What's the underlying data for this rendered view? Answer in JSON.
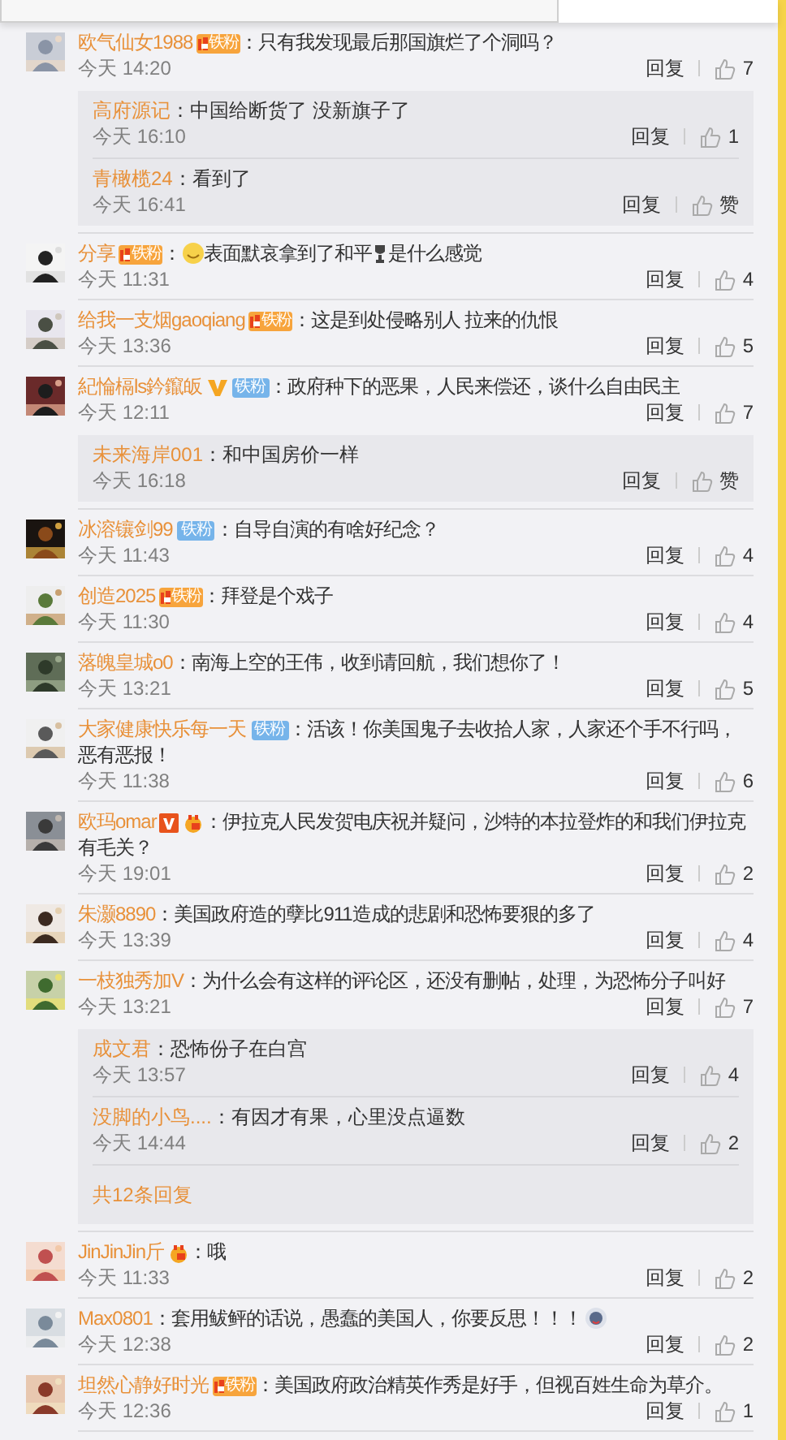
{
  "comments": [
    {
      "user": "欧气仙女1988",
      "badges": [
        {
          "kind": "fan",
          "label": "铁粉"
        }
      ],
      "content": [
        {
          "kind": "text",
          "text": "：只有我发现最后那国旗烂了个洞吗？"
        }
      ],
      "time": "今天 14:20",
      "reply": "回复",
      "likes": "7",
      "replies": [
        {
          "user": "高府源记",
          "content": "：中国给断货了 没新旗子了",
          "time": "今天 16:10",
          "reply": "回复",
          "likes": "1"
        },
        {
          "user": "青橄榄24",
          "content": "：看到了",
          "time": "今天 16:41",
          "reply": "回复",
          "likes": "赞"
        }
      ]
    },
    {
      "user": "分享",
      "badges": [
        {
          "kind": "fan",
          "label": "铁粉"
        }
      ],
      "content": [
        {
          "kind": "text",
          "text": "："
        },
        {
          "kind": "smiley"
        },
        {
          "kind": "text",
          "text": "表面默哀拿到了和平"
        },
        {
          "kind": "trophy"
        },
        {
          "kind": "text",
          "text": "是什么感觉"
        }
      ],
      "time": "今天 11:31",
      "reply": "回复",
      "likes": "4"
    },
    {
      "user": "给我一支烟gaoqiang",
      "badges": [
        {
          "kind": "fan",
          "label": "铁粉"
        }
      ],
      "content": [
        {
          "kind": "text",
          "text": "：这是到处侵略别人 拉来的仇恨"
        }
      ],
      "time": "今天 13:36",
      "reply": "回复",
      "likes": "5"
    },
    {
      "user": "紀惀槅ls鈐鑹皈",
      "badges": [
        {
          "kind": "v"
        },
        {
          "kind": "fan_blue",
          "label": "铁粉"
        }
      ],
      "content": [
        {
          "kind": "text",
          "text": "：政府种下的恶果，人民来偿还，谈什么自由民主"
        }
      ],
      "time": "今天 12:11",
      "reply": "回复",
      "likes": "7",
      "replies": [
        {
          "user": "未来海岸001",
          "content": "：和中国房价一样",
          "time": "今天 16:18",
          "reply": "回复",
          "likes": "赞"
        }
      ]
    },
    {
      "user": "冰溶镶剑99",
      "badges": [
        {
          "kind": "fan_blue",
          "label": "铁粉"
        }
      ],
      "content": [
        {
          "kind": "text",
          "text": "：自导自演的有啥好纪念？"
        }
      ],
      "time": "今天 11:43",
      "reply": "回复",
      "likes": "4"
    },
    {
      "user": "创造2025",
      "badges": [
        {
          "kind": "fan",
          "label": "铁粉"
        }
      ],
      "content": [
        {
          "kind": "text",
          "text": "：拜登是个戏子"
        }
      ],
      "time": "今天 11:30",
      "reply": "回复",
      "likes": "4"
    },
    {
      "user": "落魄皇城o0",
      "content": [
        {
          "kind": "text",
          "text": "：南海上空的王伟，收到请回航，我们想你了！"
        }
      ],
      "time": "今天 13:21",
      "reply": "回复",
      "likes": "5"
    },
    {
      "user": "大家健康快乐每一天",
      "badges": [
        {
          "kind": "fan_blue",
          "label": "铁粉"
        }
      ],
      "content": [
        {
          "kind": "text",
          "text": "：活该！你美国鬼子去收拾人家，人家还个手不行吗，恶有恶报！"
        }
      ],
      "time": "今天 11:38",
      "reply": "回复",
      "likes": "6"
    },
    {
      "user": "欧玛omar",
      "badges": [
        {
          "kind": "v_box"
        },
        {
          "kind": "medal"
        }
      ],
      "content": [
        {
          "kind": "text",
          "text": "：伊拉克人民发贺电庆祝并疑问，沙特的本拉登炸的和我们伊拉克有毛关？"
        }
      ],
      "time": "今天 19:01",
      "reply": "回复",
      "likes": "2"
    },
    {
      "user": "朱灏8890",
      "content": [
        {
          "kind": "text",
          "text": "：美国政府造的孽比911造成的悲剧和恐怖要狠的多了"
        }
      ],
      "time": "今天 13:39",
      "reply": "回复",
      "likes": "4"
    },
    {
      "user": "一枝独秀加V",
      "content": [
        {
          "kind": "text",
          "text": "：为什么会有这样的评论区，还没有删帖，处理，为恐怖分子叫好"
        }
      ],
      "time": "今天 13:21",
      "reply": "回复",
      "likes": "7",
      "replies": [
        {
          "user": "成文君",
          "content": "：恐怖份子在白宫",
          "time": "今天 13:57",
          "reply": "回复",
          "likes": "4"
        },
        {
          "user": "没脚的小鸟....",
          "content": "：有因才有果，心里没点逼数",
          "time": "今天 14:44",
          "reply": "回复",
          "likes": "2"
        }
      ],
      "more_replies": "共12条回复"
    },
    {
      "user": "JinJinJin斤",
      "badges": [
        {
          "kind": "medal"
        }
      ],
      "content": [
        {
          "kind": "text",
          "text": "：哦"
        }
      ],
      "time": "今天 11:33",
      "reply": "回复",
      "likes": "2"
    },
    {
      "user": "Max0801",
      "content": [
        {
          "kind": "text",
          "text": "：套用鲅鲆的话说，愚蠢的美国人，你要反思！！！"
        },
        {
          "kind": "sticker"
        }
      ],
      "time": "今天 12:38",
      "reply": "回复",
      "likes": "2"
    },
    {
      "user": "坦然心静好时光",
      "badges": [
        {
          "kind": "fan",
          "label": "铁粉"
        }
      ],
      "content": [
        {
          "kind": "text",
          "text": "：美国政府政治精英作秀是好手，但视百姓生命为草介。"
        }
      ],
      "time": "今天 12:36",
      "reply": "回复",
      "likes": "1"
    }
  ]
}
